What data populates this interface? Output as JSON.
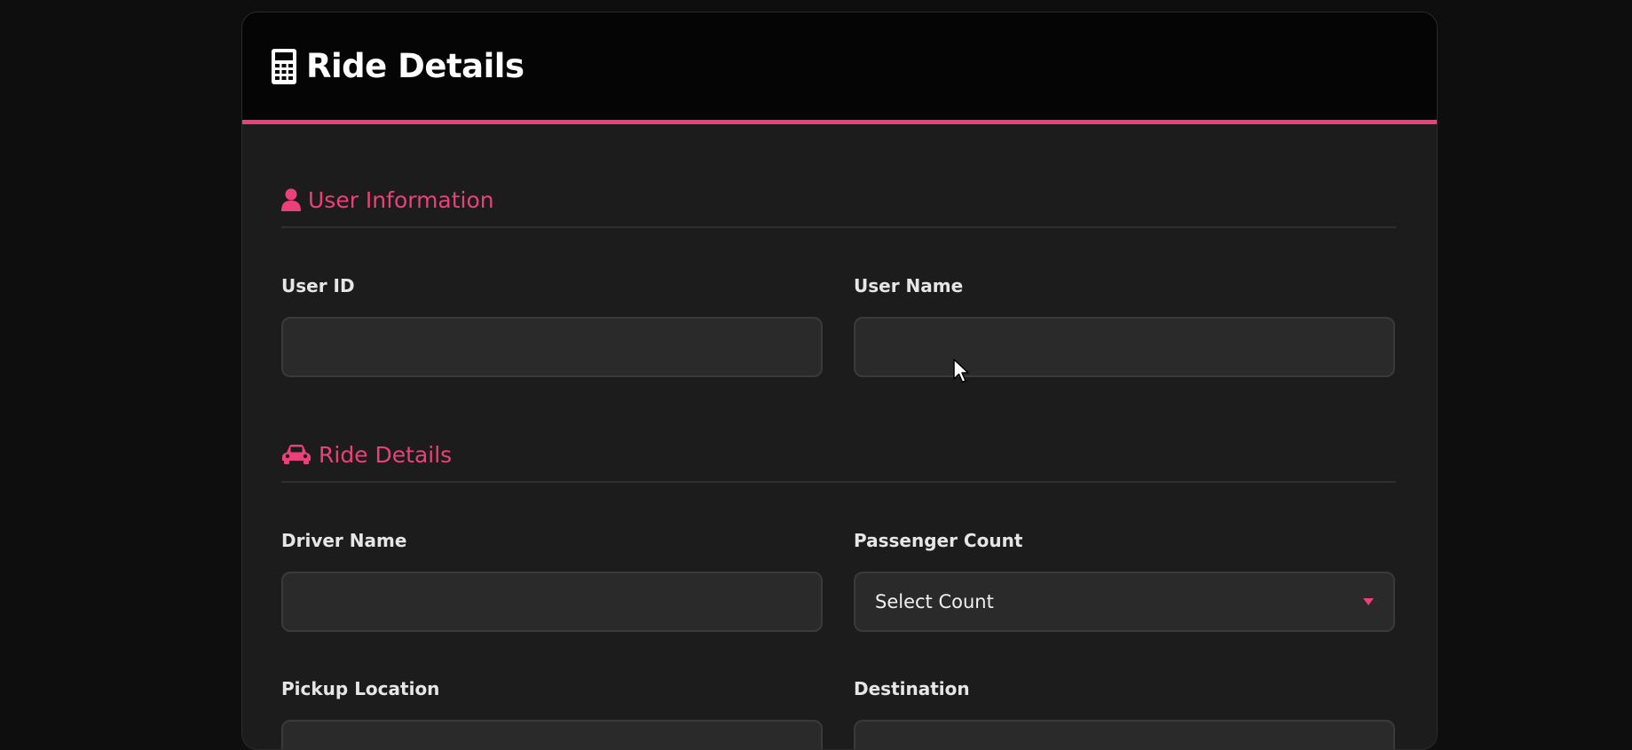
{
  "header": {
    "title": "Ride Details",
    "icon": "calculator-icon"
  },
  "sections": {
    "user": {
      "title": "User Information",
      "icon": "user-icon"
    },
    "ride": {
      "title": "Ride Details",
      "icon": "car-icon"
    }
  },
  "fields": {
    "user_id": {
      "label": "User ID",
      "value": ""
    },
    "user_name": {
      "label": "User Name",
      "value": ""
    },
    "driver_name": {
      "label": "Driver Name",
      "value": ""
    },
    "passenger_count": {
      "label": "Passenger Count",
      "value": "Select Count"
    },
    "pickup_location": {
      "label": "Pickup Location",
      "value": ""
    },
    "destination": {
      "label": "Destination",
      "value": ""
    }
  },
  "colors": {
    "accent": "#ec407a",
    "background": "#0e0e0f",
    "card": "#1c1c1d",
    "input": "#2a2a2b"
  }
}
